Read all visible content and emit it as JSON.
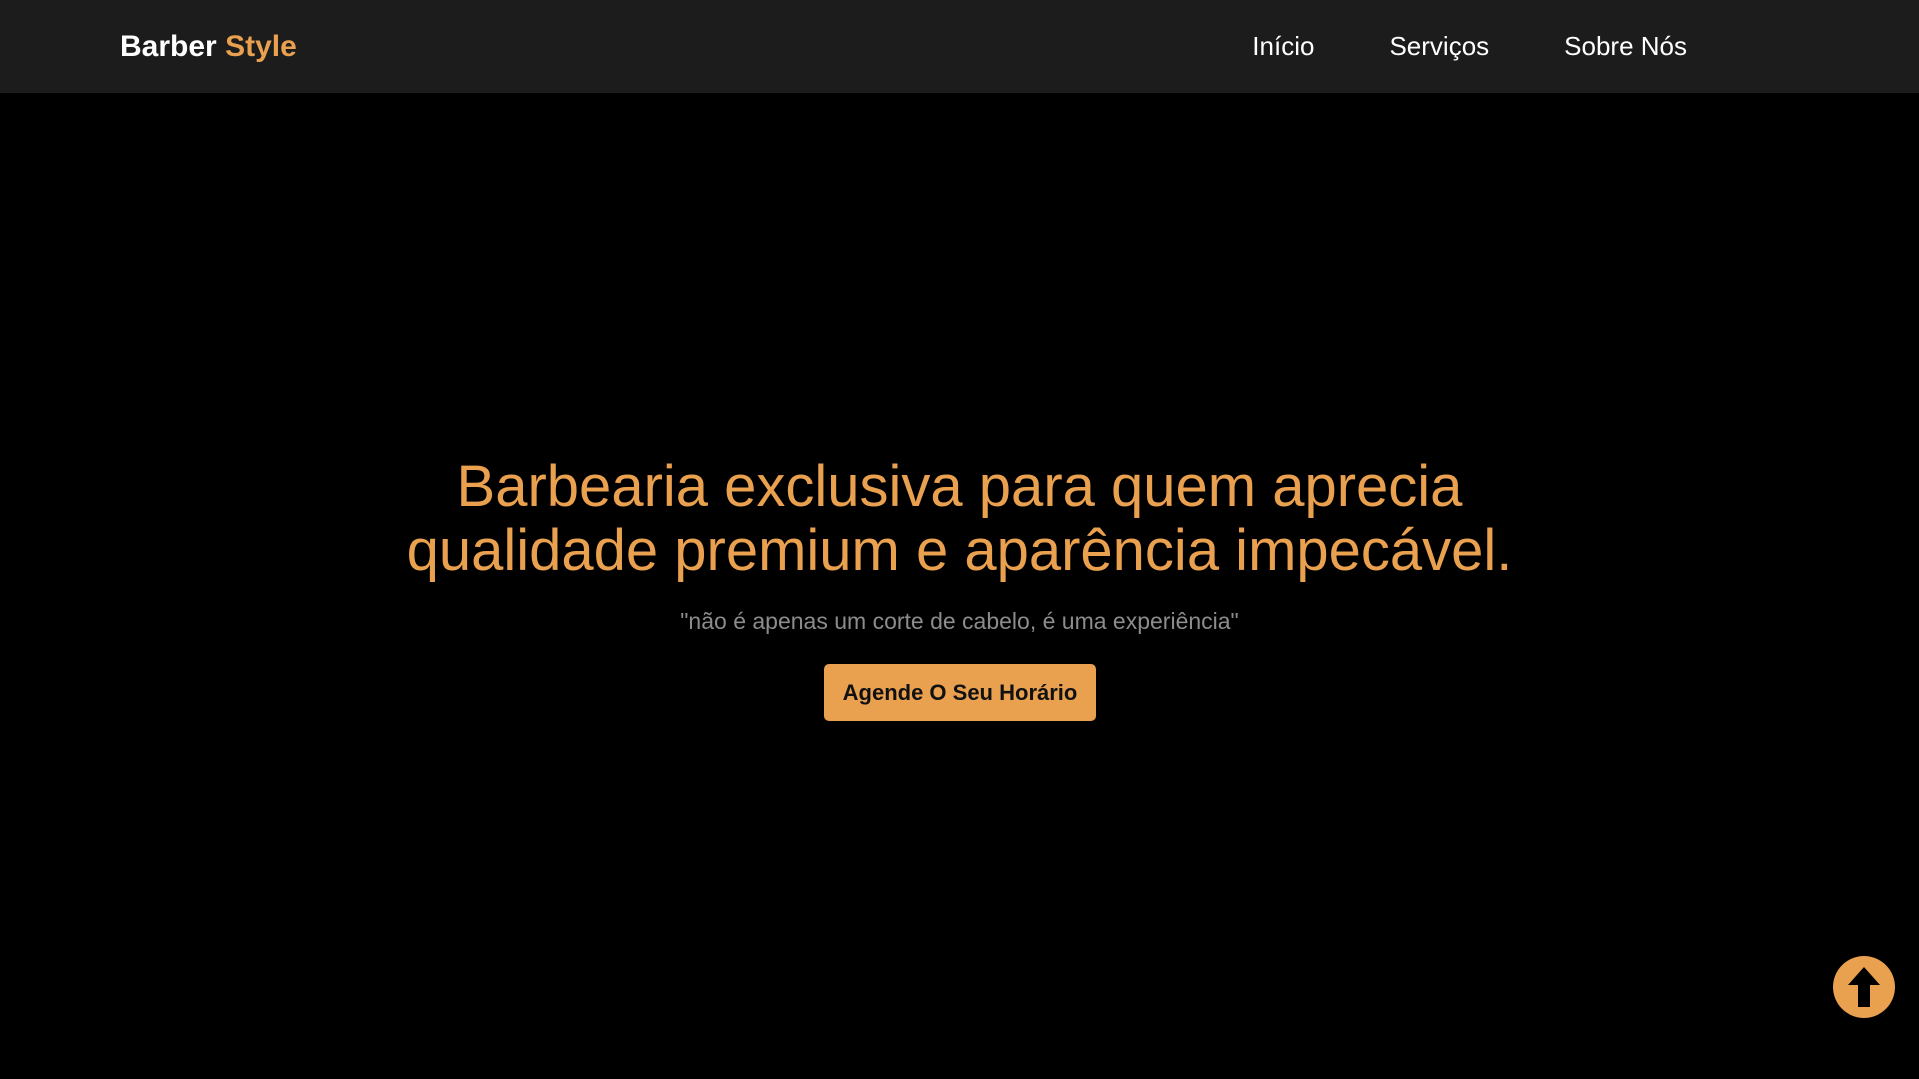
{
  "header": {
    "brand_primary": "Barber",
    "brand_accent": "Style",
    "nav": [
      {
        "label": "Início"
      },
      {
        "label": "Serviços"
      },
      {
        "label": "Sobre Nós"
      }
    ]
  },
  "hero": {
    "title_line1": "Barbearia exclusiva para quem aprecia",
    "title_line2": "qualidade premium e aparência impecável.",
    "subtitle": "\"não é apenas um corte de cabelo, é uma experiência\"",
    "cta_label": "Agende O Seu Horário"
  },
  "scroll_top": {
    "icon": "arrow-up-icon"
  },
  "colors": {
    "accent": "#e9a04f",
    "navbar_bg": "#1c1c1c",
    "page_bg": "#000000",
    "subtitle": "#8c8c8c"
  }
}
